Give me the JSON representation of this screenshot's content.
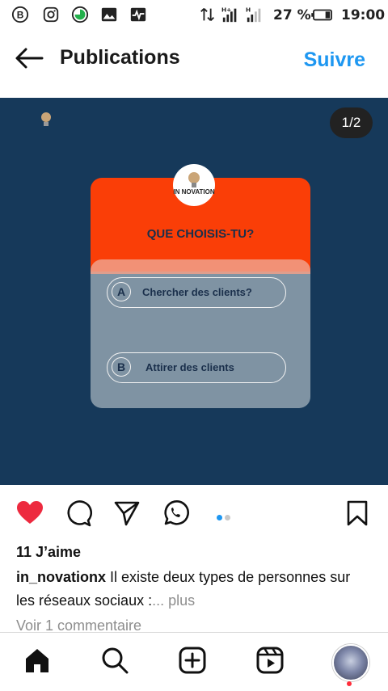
{
  "status_bar": {
    "battery": "27 %",
    "time": "19:00",
    "network_labels": [
      "H+",
      "H"
    ]
  },
  "header": {
    "title": "Publications",
    "follow_label": "Suivre"
  },
  "post": {
    "counter": "1/2",
    "brand_logo_text": "IN NOVATION",
    "round_logo_text": "IN NOVATION",
    "question": "QUE CHOISIS-TU?",
    "options": [
      {
        "letter": "A",
        "label": "Chercher des clients?"
      },
      {
        "letter": "B",
        "label": "Attirer des clients"
      }
    ],
    "colors": {
      "background": "#16395a",
      "card_top": "#fa3e07",
      "card_bottom": "#7f93a3",
      "text": "#1a2f4b"
    }
  },
  "actions": {
    "like_icon": "heart-icon",
    "comment_icon": "comment-icon",
    "share_icon": "send-icon",
    "whatsapp_icon": "whatsapp-icon",
    "save_icon": "bookmark-icon",
    "carousel_active_index": 1,
    "carousel_total": 2,
    "colors": {
      "like": "#ed2a3f",
      "dot_active": "#1e97f1",
      "dot_inactive": "#c8c8c8"
    }
  },
  "caption": {
    "likes": "11 J’aime",
    "username": "in_novationx",
    "text": "Il existe deux types de personnes sur les réseaux sociaux :",
    "more": "... plus",
    "view_comments": "Voir 1 commentaire"
  },
  "bottom_nav": {
    "items": [
      "home-icon",
      "search-icon",
      "create-icon",
      "reels-icon",
      "profile-avatar"
    ]
  },
  "accent": "#1e97f1"
}
